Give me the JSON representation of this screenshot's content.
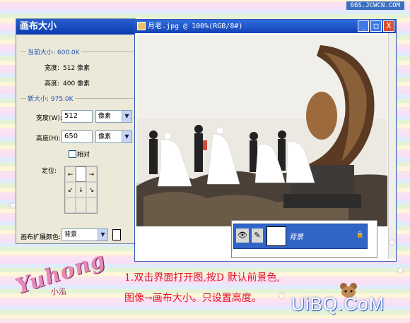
{
  "watermark": "66S.JCWCN.COM",
  "dialog": {
    "title": "画布大小",
    "current": {
      "label": "当前大小: 600.0K",
      "width_label": "宽度:",
      "width_value": "512 像素",
      "height_label": "高度:",
      "height_value": "400 像素"
    },
    "new": {
      "label": "新大小: 975.0K",
      "width_label": "宽度(W):",
      "width_value": "512",
      "width_unit": "像素",
      "height_label": "高度(H):",
      "height_value": "650",
      "height_unit": "像素",
      "relative_label": "相对",
      "anchor_label": "定位:"
    },
    "extension_label": "画布扩展颜色:",
    "extension_value": "背景"
  },
  "image_window": {
    "title": "月老.jpg @ 100%(RGB/8#)",
    "buttons": {
      "minimize": "_",
      "maximize": "□",
      "close": "X"
    }
  },
  "layers": {
    "layer_name": "背景"
  },
  "caption": {
    "line1": "1.双击界面打开图,按D 默认前景色,",
    "line2": "图像→画布大小。只设置高度。"
  },
  "logo": {
    "text": "Yuhong",
    "sub": "小泓"
  },
  "site": "UiBQ.CoM",
  "icons": [
    "app-icon",
    "eye-icon",
    "brush-icon",
    "lock-icon",
    "star-icon",
    "cartoon-mouse-icon"
  ],
  "colors": {
    "title_bar": "#1442b4",
    "caption": "#e0102c",
    "layer_selected": "#3264c8"
  }
}
